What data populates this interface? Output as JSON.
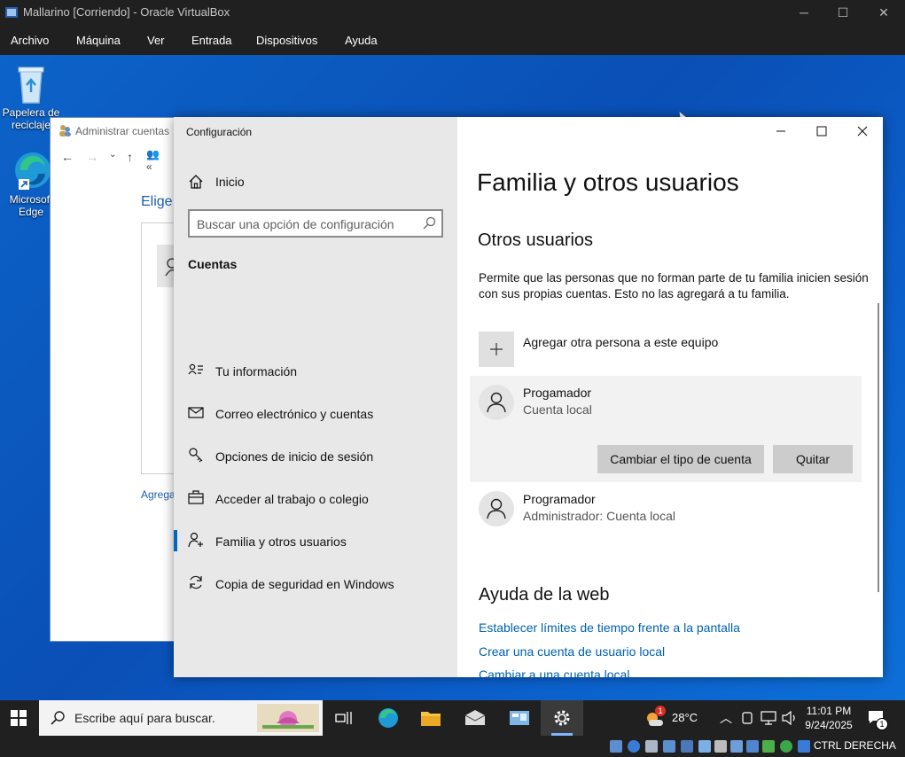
{
  "vbox": {
    "title": "Mallarino [Corriendo] - Oracle VirtualBox",
    "menu": [
      "Archivo",
      "Máquina",
      "Ver",
      "Entrada",
      "Dispositivos",
      "Ayuda"
    ],
    "host_key": "CTRL DERECHA"
  },
  "desktop": {
    "icons": [
      {
        "label": "Papelera de reciclaje",
        "icon": "recycle-bin-icon"
      },
      {
        "label": "Microsoft Edge",
        "icon": "edge-icon"
      }
    ]
  },
  "control_panel": {
    "title": "Administrar cuentas",
    "heading": "Elige",
    "link": "Agrega"
  },
  "settings": {
    "window_title": "Configuración",
    "home_label": "Inicio",
    "search_placeholder": "Buscar una opción de configuración",
    "section": "Cuentas",
    "nav": [
      {
        "label": "Tu información",
        "icon": "person-card-icon"
      },
      {
        "label": "Correo electrónico y cuentas",
        "icon": "mail-icon"
      },
      {
        "label": "Opciones de inicio de sesión",
        "icon": "key-icon"
      },
      {
        "label": "Acceder al trabajo o colegio",
        "icon": "briefcase-icon"
      },
      {
        "label": "Familia y otros usuarios",
        "icon": "add-person-icon",
        "active": true
      },
      {
        "label": "Copia de seguridad en Windows",
        "icon": "sync-icon"
      }
    ],
    "page_title": "Familia y otros usuarios",
    "other_users_heading": "Otros usuarios",
    "other_users_desc": "Permite que las personas que no forman parte de tu familia inicien sesión con sus propias cuentas. Esto no las agregará a tu familia.",
    "add_person_label": "Agregar otra persona a este equipo",
    "users": [
      {
        "name": "Progamador",
        "type": "Cuenta local",
        "selected": true
      },
      {
        "name": "Programador",
        "type": "Administrador: Cuenta local",
        "selected": false
      }
    ],
    "change_type_label": "Cambiar el tipo de cuenta",
    "remove_label": "Quitar",
    "help_heading": "Ayuda de la web",
    "help_links": [
      "Establecer límites de tiempo frente a la pantalla",
      "Crear una cuenta de usuario local",
      "Cambiar a una cuenta local"
    ]
  },
  "taskbar": {
    "search_placeholder": "Escribe aquí para buscar.",
    "weather_temp": "28°C",
    "weather_badge": "1",
    "time": "11:01 PM",
    "date": "9/24/2025",
    "notification_count": "1"
  },
  "colors": {
    "accent": "#0067c0",
    "link": "#0060b0",
    "desktop_blue": "#0a4fb5"
  }
}
